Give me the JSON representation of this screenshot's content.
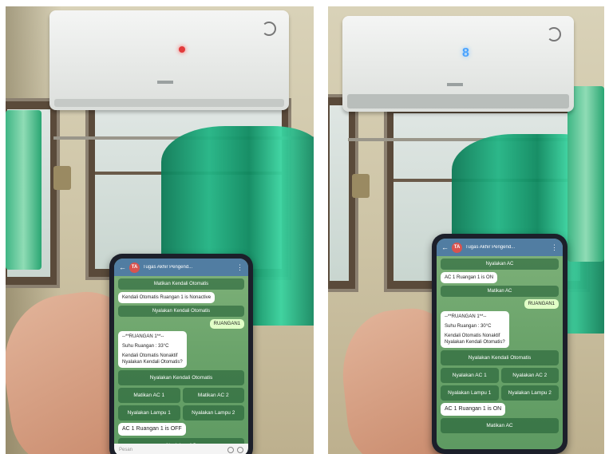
{
  "left_photo": {
    "chat_title": "Tugas Akhir Pengend...",
    "avatar": "TA",
    "messages": {
      "kb_top": "Matikan Kendali Otomatis",
      "msg_nonactive": "Kendali Otomatis Ruangan 1 is Nonactive",
      "kb_nyalakan_kendali_1": "Nyalakan Kendali Otomatis",
      "out_ruangan": "RUANGAN1",
      "status_lines": [
        "--**RUANGAN 1**--",
        "Suhu Ruangan : 33°C",
        "Kendali Otomatis Nonaktif",
        "Nyalakan Kendali Otomatis?"
      ],
      "kb_nyalakan_kendali_2": "Nyalakan Kendali Otomatis",
      "kb_matikan_ac1": "Matikan AC 1",
      "kb_matikan_ac2": "Matikan AC 2",
      "kb_lampu1": "Nyalakan Lampu 1",
      "kb_lampu2": "Nyalakan Lampu 2",
      "msg_ac_status": "AC 1 Ruangan 1 is OFF",
      "kb_nyalakan_ac": "Nyalakan AC"
    },
    "input_placeholder": "Pesan"
  },
  "right_photo": {
    "chat_title": "Tugas Akhir Pengend...",
    "avatar": "TA",
    "messages": {
      "kb_nyalakan_ac": "Nyalakan AC",
      "msg_ac_status_top": "AC 1 Ruangan 1 is ON",
      "kb_matikan_ac": "Matikan AC",
      "out_ruangan": "RUANGAN1",
      "status_lines": [
        "--**RUANGAN 1**--",
        "Suhu Ruangan : 30°C",
        "Kendali Otomatis Nonaktif",
        "Nyalakan Kendali Otomatis?"
      ],
      "kb_nyalakan_kendali": "Nyalakan Kendali Otomatis",
      "kb_nyalakan_ac1": "Nyalakan AC 1",
      "kb_nyalakan_ac2": "Nyalakan AC 2",
      "kb_lampu1": "Nyalakan Lampu 1",
      "kb_lampu2": "Nyalakan Lampu 2",
      "msg_ac_status": "AC 1 Ruangan 1 is ON",
      "kb_matikan_ac_bottom": "Matikan AC"
    },
    "ac_display": "8"
  },
  "colors": {
    "curtain": "#1fae7f",
    "telegram_header": "#517da2",
    "ac_indicator_off": "#e23b3b",
    "ac_display_on": "#4aa3ff"
  }
}
